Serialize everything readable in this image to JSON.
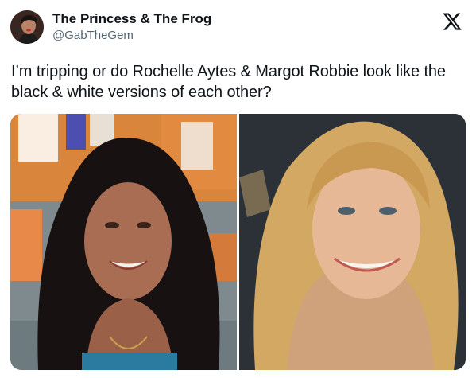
{
  "tweet": {
    "display_name": "The Princess & The Frog",
    "handle": "@GabTheGem",
    "text": "I’m tripping or do Rochelle Aytes & Margot Robbie look like the black & white versions of each other?"
  },
  "icons": {
    "brand": "x-logo-icon"
  },
  "media": {
    "count": 2
  },
  "colors": {
    "text_primary": "#0f1419",
    "text_secondary": "#536471",
    "background": "#ffffff"
  }
}
